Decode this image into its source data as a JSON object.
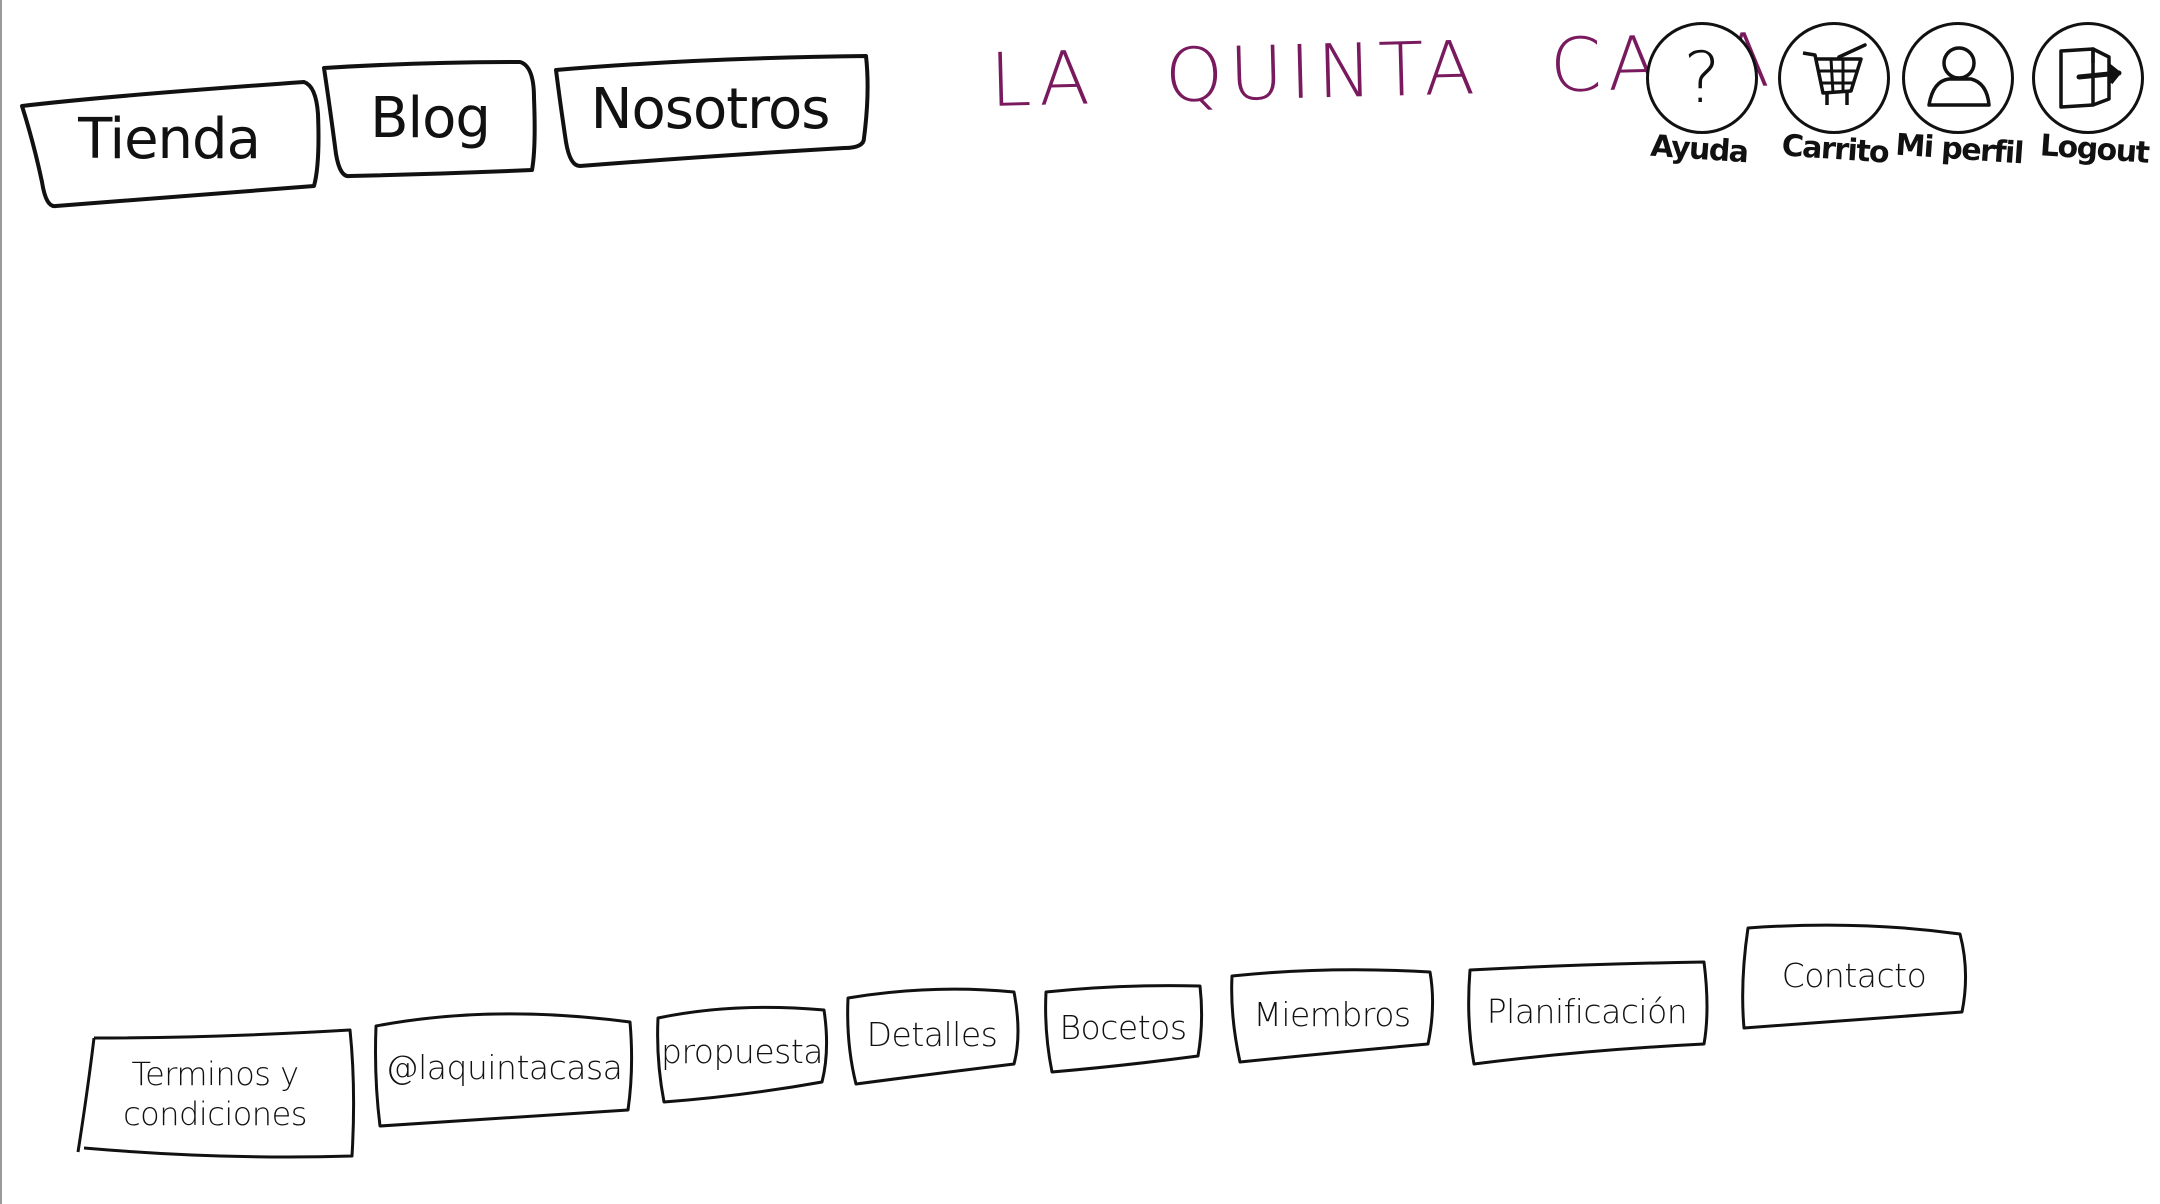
{
  "header": {
    "nav_tabs": [
      {
        "label": "Tienda"
      },
      {
        "label": "Blog"
      },
      {
        "label": "Nosotros"
      }
    ],
    "brand": {
      "title": "LA QUINTA CASA",
      "color": "#7a1a5e"
    },
    "utility_buttons": [
      {
        "label": "Ayuda",
        "icon": "question-mark-icon"
      },
      {
        "label": "Carrito",
        "icon": "cart-icon"
      },
      {
        "label": "Mi perfil",
        "icon": "user-icon"
      },
      {
        "label": "Logout",
        "icon": "logout-door-icon"
      }
    ]
  },
  "footer": {
    "links": [
      {
        "label": "Terminos y condiciones"
      },
      {
        "label": "@laquintacasa"
      },
      {
        "label": "propuesta"
      },
      {
        "label": "Detalles"
      },
      {
        "label": "Bocetos"
      },
      {
        "label": "Miembros"
      },
      {
        "label": "Planificación"
      },
      {
        "label": "Contacto"
      }
    ]
  }
}
